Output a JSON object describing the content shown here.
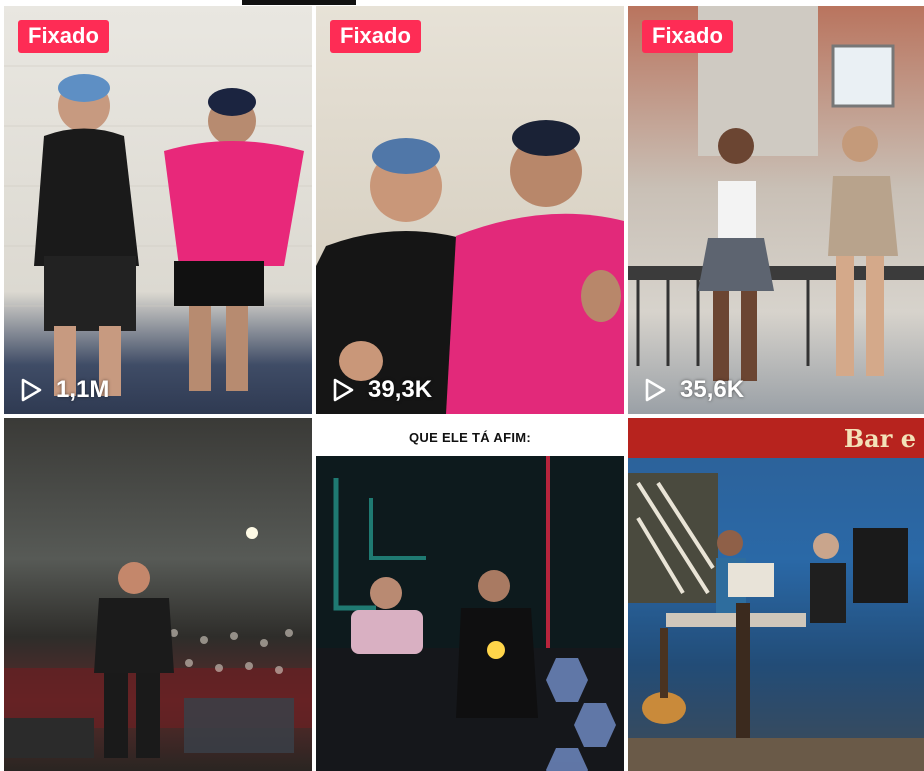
{
  "grid": {
    "videos": [
      {
        "badge": "Fixado",
        "views": "1,1M"
      },
      {
        "badge": "Fixado",
        "views": "39,3K"
      },
      {
        "badge": "Fixado",
        "views": "35,6K"
      },
      {
        "caption": ""
      },
      {
        "caption": "QUE ELE TÁ AFIM:"
      },
      {
        "sign": "Bar e"
      }
    ]
  },
  "icons": {
    "views": "play-outline-icon"
  },
  "colors": {
    "badge": "#fe2c55",
    "view_text": "#ffffff"
  }
}
